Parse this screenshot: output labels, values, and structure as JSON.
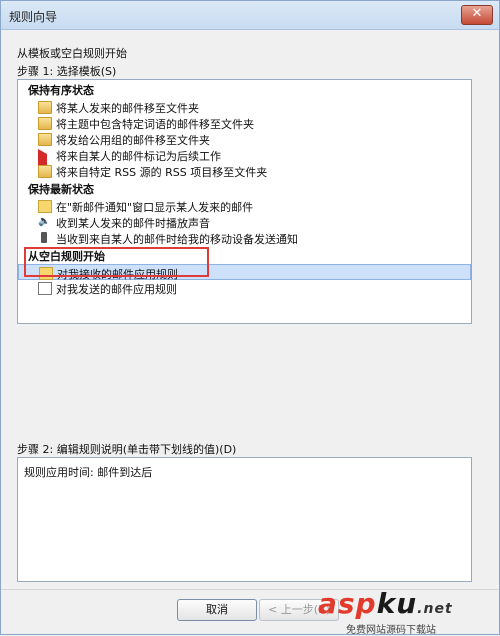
{
  "window": {
    "title": "规则向导"
  },
  "intro": "从模板或空白规则开始",
  "step1_label": "步骤 1: 选择模板(S)",
  "groups": [
    {
      "title": "保持有序状态",
      "items": [
        {
          "label": "将某人发来的邮件移至文件夹",
          "icon": "folder-icon"
        },
        {
          "label": "将主题中包含特定词语的邮件移至文件夹",
          "icon": "folder-icon"
        },
        {
          "label": "将发给公用组的邮件移至文件夹",
          "icon": "folder-icon"
        },
        {
          "label": "将来自某人的邮件标记为后续工作",
          "icon": "flag-icon"
        },
        {
          "label": "将来自特定 RSS 源的 RSS 项目移至文件夹",
          "icon": "folder-icon"
        }
      ]
    },
    {
      "title": "保持最新状态",
      "items": [
        {
          "label": "在\"新邮件通知\"窗口显示某人发来的邮件",
          "icon": "alert-icon"
        },
        {
          "label": "收到某人发来的邮件时播放声音",
          "icon": "speaker-icon"
        },
        {
          "label": "当收到来自某人的邮件时给我的移动设备发送通知",
          "icon": "phone-icon"
        }
      ]
    },
    {
      "title": "从空白规则开始",
      "items": [
        {
          "label": "对我接收的邮件应用规则",
          "icon": "envelope-yellow-icon",
          "selected": true
        },
        {
          "label": "对我发送的邮件应用规则",
          "icon": "envelope-blank-icon"
        }
      ]
    }
  ],
  "step2_label": "步骤 2: 编辑规则说明(单击带下划线的值)(D)",
  "description": "规则应用时间: 邮件到达后",
  "buttons": {
    "cancel": "取消",
    "back": "< 上一步(B)"
  },
  "watermark": {
    "logo_a": "asp",
    "logo_b": "ku",
    "logo_net": ".net",
    "sub": "免费网站源码下载站"
  }
}
